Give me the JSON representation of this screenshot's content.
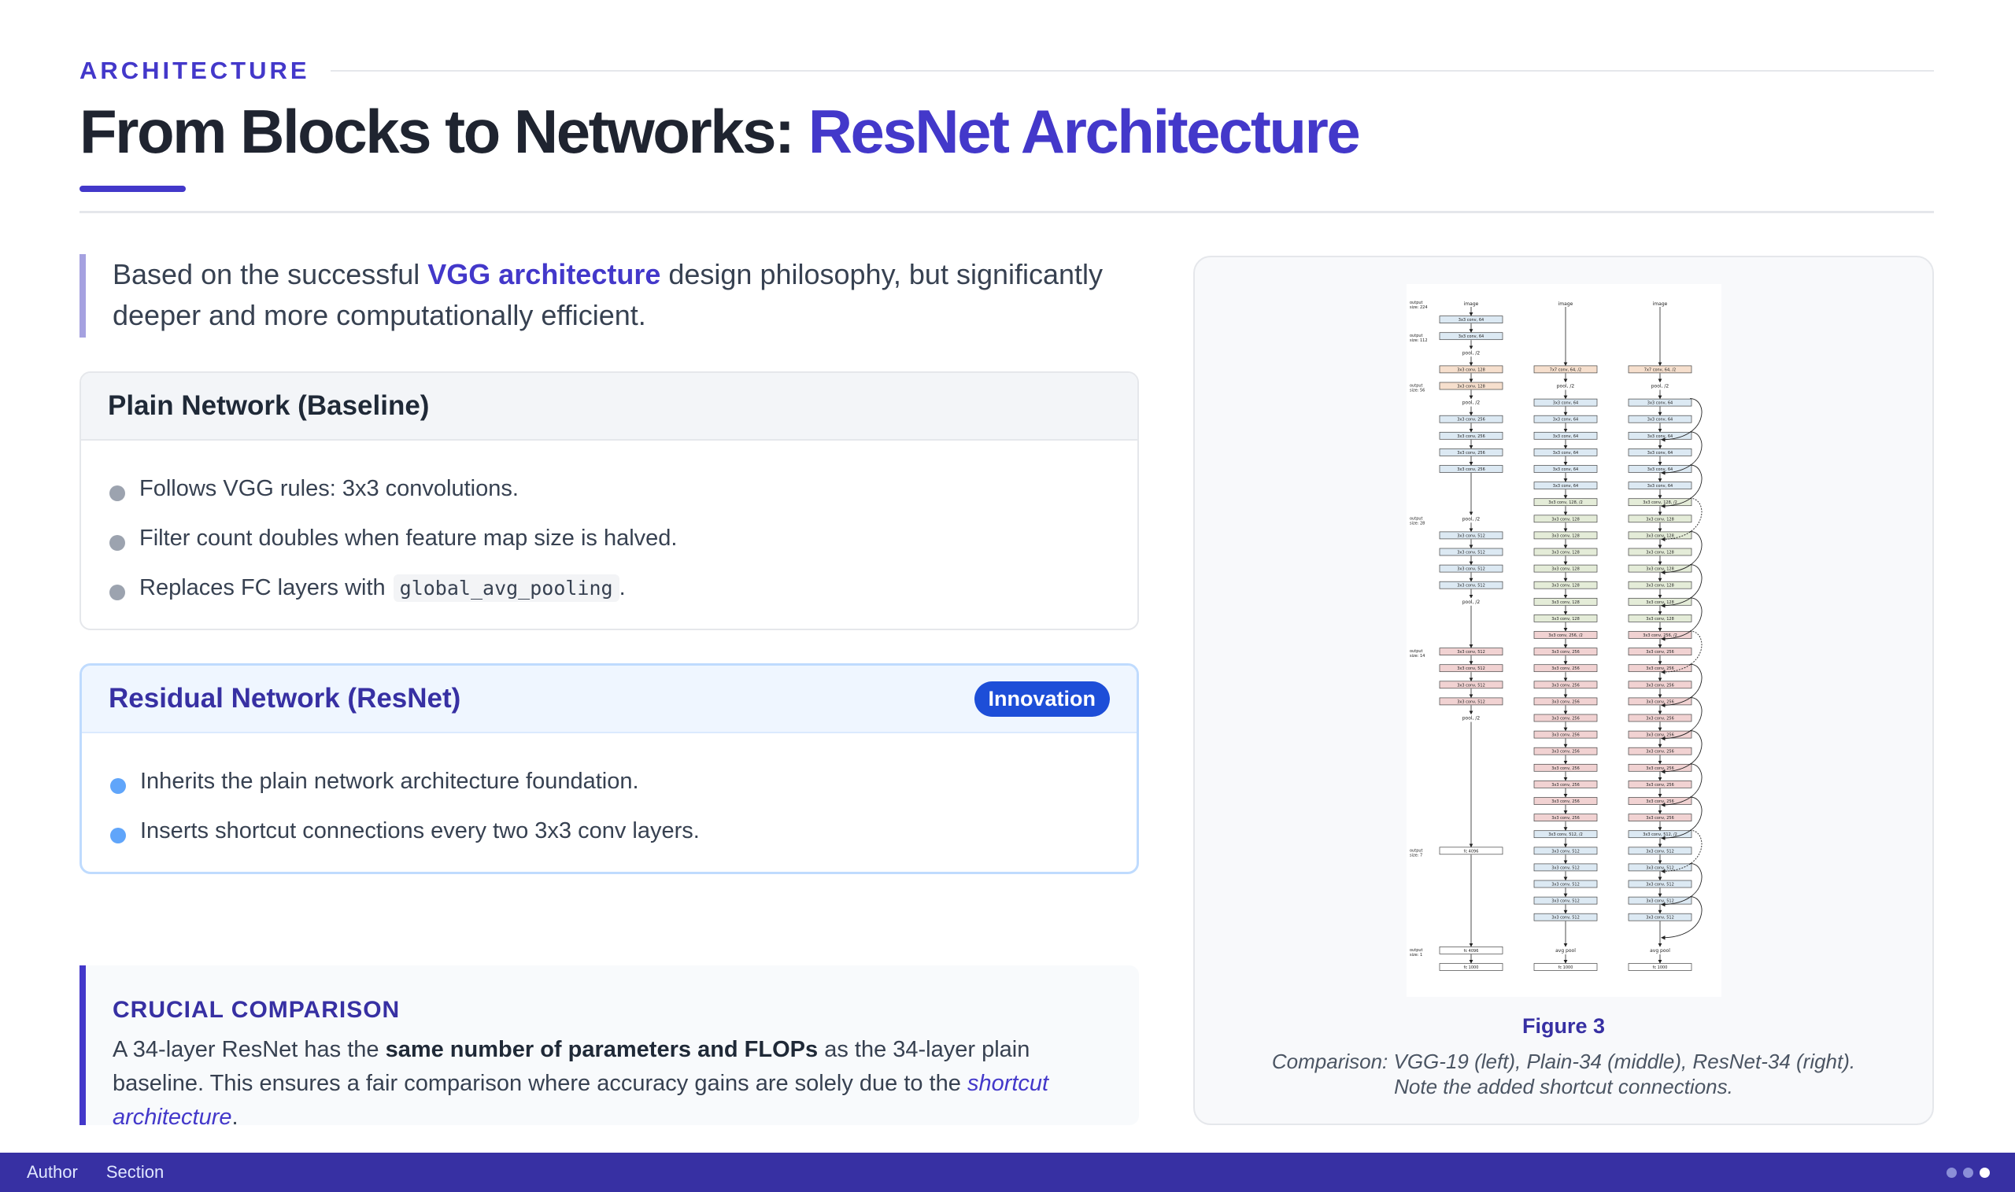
{
  "header": {
    "kicker": "ARCHITECTURE",
    "title_main": "From Blocks to Networks: ",
    "title_accent": "ResNet Architecture"
  },
  "intro": {
    "before": "Based on the successful ",
    "highlight": "VGG architecture",
    "after": " design philosophy, but significantly deeper and more computationally efficient."
  },
  "plain_card": {
    "title": "Plain Network (Baseline)",
    "items": [
      {
        "text": "Follows VGG rules: 3x3 convolutions.",
        "code": ""
      },
      {
        "text": "Filter count doubles when feature map size is halved.",
        "code": ""
      },
      {
        "text": "Replaces FC layers with ",
        "code": "global_avg_pooling",
        "suffix": "."
      }
    ]
  },
  "resnet_card": {
    "title": "Residual Network (ResNet)",
    "badge": "Innovation",
    "items": [
      {
        "text": "Inherits the plain network architecture foundation."
      },
      {
        "text": "Inserts shortcut connections every two 3x3 conv layers."
      }
    ]
  },
  "crucial": {
    "title": "CRUCIAL COMPARISON",
    "before": "A 34-layer ResNet has the ",
    "bold": "same number of parameters and FLOPs",
    "middle": " as the 34-layer plain baseline. This ensures a fair comparison where accuracy gains are solely due to the ",
    "italic": "shortcut architecture",
    "end": "."
  },
  "figure": {
    "label": "Figure 3",
    "caption_line1": "Comparison: VGG-19 (left), Plain-34 (middle), ResNet-34 (right).",
    "caption_line2": "Note the added shortcut connections.",
    "diagram": {
      "columns": [
        {
          "id": "vgg",
          "input": "image",
          "layers": [
            {
              "l": "3x3 conv, 64",
              "g": 0
            },
            {
              "l": "3x3 conv, 64",
              "g": 0
            },
            {
              "l": "pool, /2",
              "g": -1
            },
            {
              "l": "3x3 conv, 128",
              "g": 1
            },
            {
              "l": "3x3 conv, 128",
              "g": 1
            },
            {
              "l": "pool, /2",
              "g": -1
            },
            {
              "l": "3x3 conv, 256",
              "g": 0
            },
            {
              "l": "3x3 conv, 256",
              "g": 0
            },
            {
              "l": "3x3 conv, 256",
              "g": 0
            },
            {
              "l": "3x3 conv, 256",
              "g": 0
            },
            {
              "l": "pool, /2",
              "g": -1
            },
            {
              "l": "3x3 conv, 512",
              "g": 0
            },
            {
              "l": "3x3 conv, 512",
              "g": 0
            },
            {
              "l": "3x3 conv, 512",
              "g": 0
            },
            {
              "l": "3x3 conv, 512",
              "g": 0
            },
            {
              "l": "pool, /2",
              "g": -1
            },
            {
              "l": "3x3 conv, 512",
              "g": 2
            },
            {
              "l": "3x3 conv, 512",
              "g": 2
            },
            {
              "l": "3x3 conv, 512",
              "g": 2
            },
            {
              "l": "3x3 conv, 512",
              "g": 2
            },
            {
              "l": "pool, /2",
              "g": -1
            },
            {
              "l": "fc 4096",
              "g": 3
            },
            {
              "l": "fc 4096",
              "g": 3
            },
            {
              "l": "fc 1000",
              "g": 3
            }
          ]
        },
        {
          "id": "plain",
          "input": "image",
          "layers": [
            {
              "l": "7x7 conv, 64, /2",
              "g": 1
            },
            {
              "l": "pool, /2",
              "g": -1
            },
            {
              "l": "3x3 conv, 64",
              "g": 0
            },
            {
              "l": "3x3 conv, 64",
              "g": 0
            },
            {
              "l": "3x3 conv, 64",
              "g": 0
            },
            {
              "l": "3x3 conv, 64",
              "g": 0
            },
            {
              "l": "3x3 conv, 64",
              "g": 0
            },
            {
              "l": "3x3 conv, 64",
              "g": 0
            },
            {
              "l": "3x3 conv, 128, /2",
              "g": 4
            },
            {
              "l": "3x3 conv, 128",
              "g": 4
            },
            {
              "l": "3x3 conv, 128",
              "g": 4
            },
            {
              "l": "3x3 conv, 128",
              "g": 4
            },
            {
              "l": "3x3 conv, 128",
              "g": 4
            },
            {
              "l": "3x3 conv, 128",
              "g": 4
            },
            {
              "l": "3x3 conv, 128",
              "g": 4
            },
            {
              "l": "3x3 conv, 128",
              "g": 4
            },
            {
              "l": "3x3 conv, 256, /2",
              "g": 2
            },
            {
              "l": "3x3 conv, 256",
              "g": 2
            },
            {
              "l": "3x3 conv, 256",
              "g": 2
            },
            {
              "l": "3x3 conv, 256",
              "g": 2
            },
            {
              "l": "3x3 conv, 256",
              "g": 2
            },
            {
              "l": "3x3 conv, 256",
              "g": 2
            },
            {
              "l": "3x3 conv, 256",
              "g": 2
            },
            {
              "l": "3x3 conv, 256",
              "g": 2
            },
            {
              "l": "3x3 conv, 256",
              "g": 2
            },
            {
              "l": "3x3 conv, 256",
              "g": 2
            },
            {
              "l": "3x3 conv, 256",
              "g": 2
            },
            {
              "l": "3x3 conv, 256",
              "g": 2
            },
            {
              "l": "3x3 conv, 512, /2",
              "g": 0
            },
            {
              "l": "3x3 conv, 512",
              "g": 0
            },
            {
              "l": "3x3 conv, 512",
              "g": 0
            },
            {
              "l": "3x3 conv, 512",
              "g": 0
            },
            {
              "l": "3x3 conv, 512",
              "g": 0
            },
            {
              "l": "3x3 conv, 512",
              "g": 0
            },
            {
              "l": "avg pool",
              "g": -1
            },
            {
              "l": "fc 1000",
              "g": 3
            }
          ]
        },
        {
          "id": "resnet",
          "input": "image",
          "layers": [
            {
              "l": "7x7 conv, 64, /2",
              "g": 1
            },
            {
              "l": "pool, /2",
              "g": -1
            },
            {
              "l": "3x3 conv, 64",
              "g": 0
            },
            {
              "l": "3x3 conv, 64",
              "g": 0
            },
            {
              "l": "3x3 conv, 64",
              "g": 0
            },
            {
              "l": "3x3 conv, 64",
              "g": 0
            },
            {
              "l": "3x3 conv, 64",
              "g": 0
            },
            {
              "l": "3x3 conv, 64",
              "g": 0
            },
            {
              "l": "3x3 conv, 128, /2",
              "g": 4
            },
            {
              "l": "3x3 conv, 128",
              "g": 4
            },
            {
              "l": "3x3 conv, 128",
              "g": 4
            },
            {
              "l": "3x3 conv, 128",
              "g": 4
            },
            {
              "l": "3x3 conv, 128",
              "g": 4
            },
            {
              "l": "3x3 conv, 128",
              "g": 4
            },
            {
              "l": "3x3 conv, 128",
              "g": 4
            },
            {
              "l": "3x3 conv, 128",
              "g": 4
            },
            {
              "l": "3x3 conv, 256, /2",
              "g": 2
            },
            {
              "l": "3x3 conv, 256",
              "g": 2
            },
            {
              "l": "3x3 conv, 256",
              "g": 2
            },
            {
              "l": "3x3 conv, 256",
              "g": 2
            },
            {
              "l": "3x3 conv, 256",
              "g": 2
            },
            {
              "l": "3x3 conv, 256",
              "g": 2
            },
            {
              "l": "3x3 conv, 256",
              "g": 2
            },
            {
              "l": "3x3 conv, 256",
              "g": 2
            },
            {
              "l": "3x3 conv, 256",
              "g": 2
            },
            {
              "l": "3x3 conv, 256",
              "g": 2
            },
            {
              "l": "3x3 conv, 256",
              "g": 2
            },
            {
              "l": "3x3 conv, 256",
              "g": 2
            },
            {
              "l": "3x3 conv, 512, /2",
              "g": 0
            },
            {
              "l": "3x3 conv, 512",
              "g": 0
            },
            {
              "l": "3x3 conv, 512",
              "g": 0
            },
            {
              "l": "3x3 conv, 512",
              "g": 0
            },
            {
              "l": "3x3 conv, 512",
              "g": 0
            },
            {
              "l": "3x3 conv, 512",
              "g": 0
            },
            {
              "l": "avg pool",
              "g": -1
            },
            {
              "l": "fc 1000",
              "g": 3
            }
          ]
        }
      ],
      "group_colors": [
        "#dce9f3",
        "#f6dfcd",
        "#f1d2d2",
        "#ffffff",
        "#e4ecd8"
      ],
      "size_labels": [
        {
          "text": "output size: 224",
          "row": 0
        },
        {
          "text": "output size: 112",
          "row": 2
        },
        {
          "text": "output size: 56",
          "row": 5
        },
        {
          "text": "output size: 28",
          "row": 13
        },
        {
          "text": "output size: 14",
          "row": 21
        },
        {
          "text": "output size: 7",
          "row": 33
        },
        {
          "text": "output size: 1",
          "row": 39
        }
      ]
    }
  },
  "footer": {
    "author": "Author",
    "section": "Section"
  }
}
